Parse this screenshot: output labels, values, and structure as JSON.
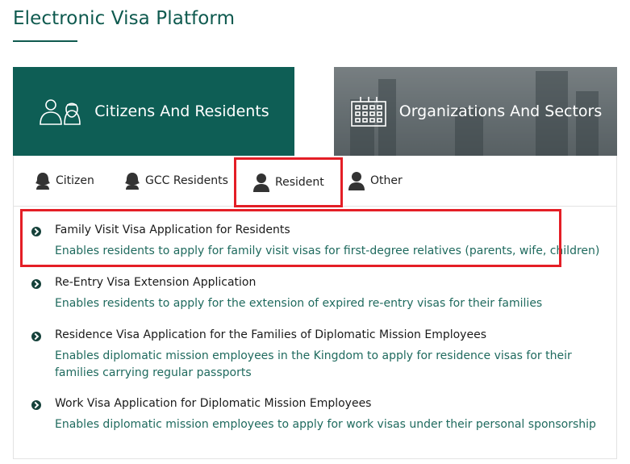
{
  "page": {
    "title": "Electronic Visa Platform"
  },
  "categories": [
    {
      "label": "Citizens And Residents",
      "icon": "citizens-residents-icon",
      "active": true
    },
    {
      "label": "Organizations And Sectors",
      "icon": "building-icon",
      "active": false
    }
  ],
  "subtabs": [
    {
      "label": "Citizen",
      "icon": "female-user-icon"
    },
    {
      "label": "GCC Residents",
      "icon": "female-user-icon"
    },
    {
      "label": "Resident",
      "icon": "user-icon",
      "selected": true
    },
    {
      "label": "Other",
      "icon": "user-icon"
    }
  ],
  "services": [
    {
      "title": "Family Visit Visa Application for Residents",
      "description": "Enables residents to apply for family visit visas for first-degree relatives (parents, wife, children)"
    },
    {
      "title": "Re-Entry Visa Extension Application",
      "description": "Enables residents to apply for the extension of expired re-entry visas for their families"
    },
    {
      "title": "Residence Visa Application for the Families of Diplomatic Mission Employees",
      "description": "Enables diplomatic mission employees in the Kingdom to apply for residence visas for their families carrying regular passports"
    },
    {
      "title": "Work Visa Application for Diplomatic Mission Employees",
      "description": "Enables diplomatic mission employees to apply for work visas under their personal sponsorship"
    }
  ],
  "colors": {
    "primary": "#0e5e55",
    "highlight": "#e41e26",
    "link_text": "#1f6a5e"
  }
}
